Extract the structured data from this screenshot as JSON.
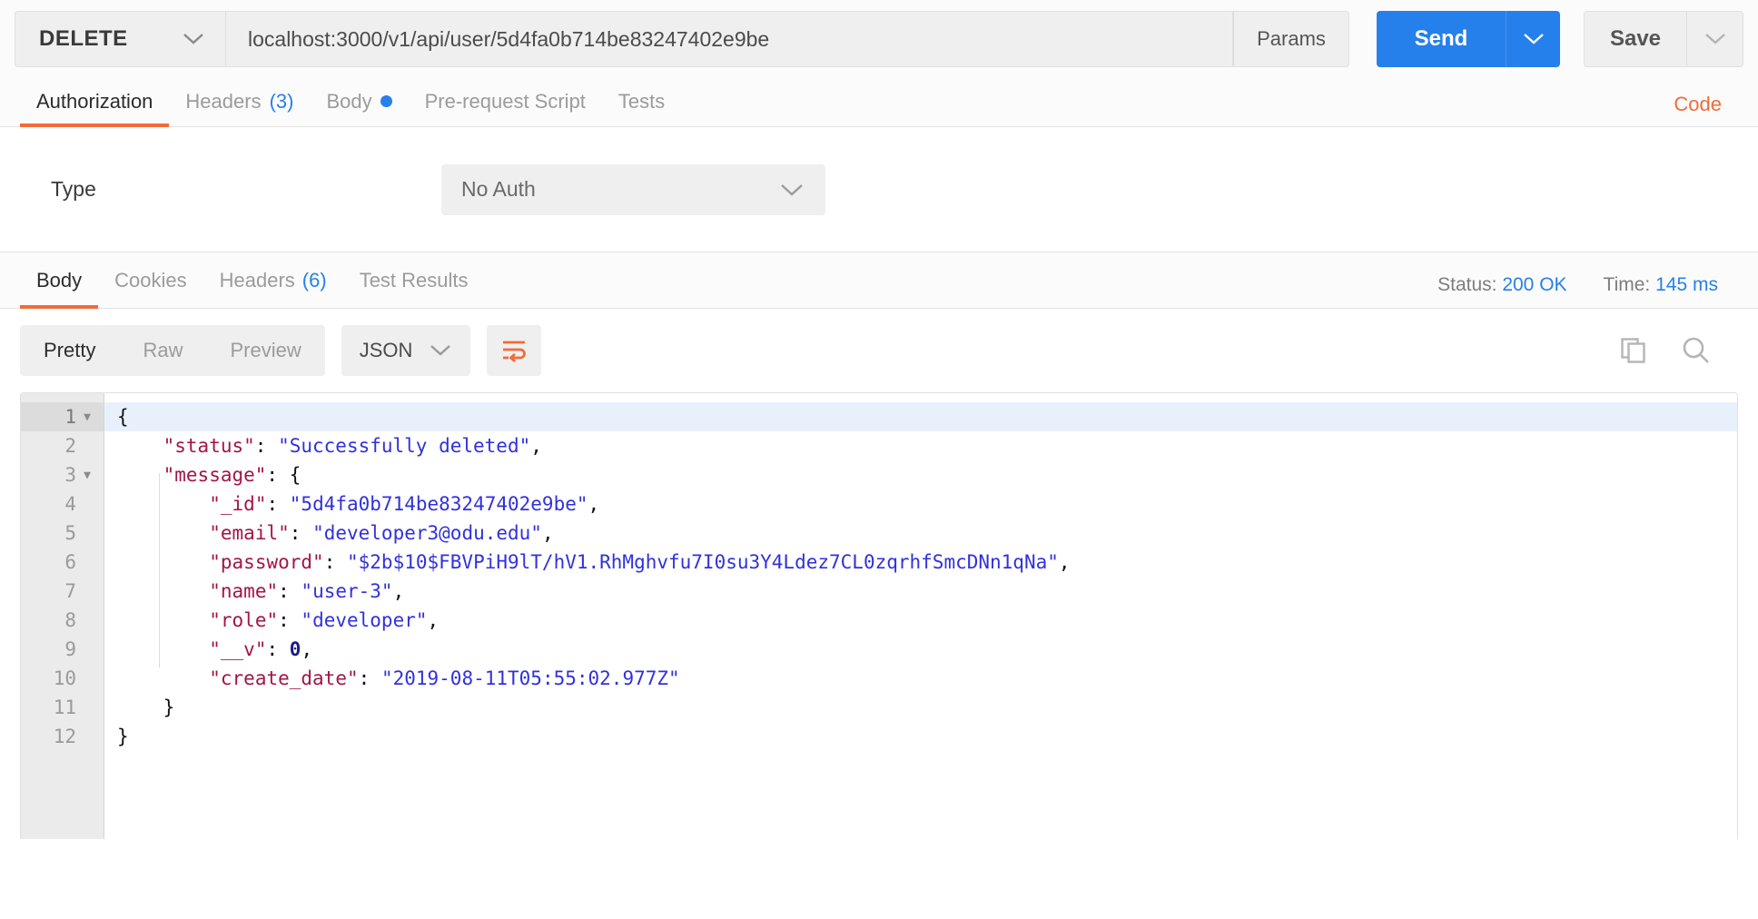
{
  "request": {
    "method": "DELETE",
    "url": "localhost:3000/v1/api/user/5d4fa0b714be83247402e9be",
    "params_label": "Params",
    "send_label": "Send",
    "save_label": "Save"
  },
  "request_tabs": {
    "items": [
      {
        "label": "Authorization",
        "count": "",
        "dot": false,
        "active": true
      },
      {
        "label": "Headers",
        "count": "(3)",
        "dot": false,
        "active": false
      },
      {
        "label": "Body",
        "count": "",
        "dot": true,
        "active": false
      },
      {
        "label": "Pre-request Script",
        "count": "",
        "dot": false,
        "active": false
      },
      {
        "label": "Tests",
        "count": "",
        "dot": false,
        "active": false
      }
    ],
    "code_link": "Code"
  },
  "auth": {
    "type_label": "Type",
    "selected": "No Auth"
  },
  "response_tabs": {
    "items": [
      {
        "label": "Body",
        "count": "",
        "active": true
      },
      {
        "label": "Cookies",
        "count": "",
        "active": false
      },
      {
        "label": "Headers",
        "count": "(6)",
        "active": false
      },
      {
        "label": "Test Results",
        "count": "",
        "active": false
      }
    ],
    "status_label": "Status:",
    "status_value": "200 OK",
    "time_label": "Time:",
    "time_value": "145 ms"
  },
  "body_toolbar": {
    "views": [
      {
        "label": "Pretty",
        "active": true
      },
      {
        "label": "Raw",
        "active": false
      },
      {
        "label": "Preview",
        "active": false
      }
    ],
    "format": "JSON",
    "wrap_icon": "word-wrap-icon",
    "copy_icon": "copy-icon",
    "search_icon": "search-icon"
  },
  "response_body": {
    "lines": [
      {
        "n": "1",
        "fold": true,
        "current": true,
        "text": "{"
      },
      {
        "n": "2",
        "fold": false,
        "current": false,
        "text": "    \"status\": \"Successfully deleted\","
      },
      {
        "n": "3",
        "fold": true,
        "current": false,
        "text": "    \"message\": {"
      },
      {
        "n": "4",
        "fold": false,
        "current": false,
        "text": "        \"_id\": \"5d4fa0b714be83247402e9be\","
      },
      {
        "n": "5",
        "fold": false,
        "current": false,
        "text": "        \"email\": \"developer3@odu.edu\","
      },
      {
        "n": "6",
        "fold": false,
        "current": false,
        "text": "        \"password\": \"$2b$10$FBVPiH9lT/hV1.RhMghvfu7I0su3Y4Ldez7CL0zqrhfSmcDNn1qNa\","
      },
      {
        "n": "7",
        "fold": false,
        "current": false,
        "text": "        \"name\": \"user-3\","
      },
      {
        "n": "8",
        "fold": false,
        "current": false,
        "text": "        \"role\": \"developer\","
      },
      {
        "n": "9",
        "fold": false,
        "current": false,
        "text": "        \"__v\": 0,"
      },
      {
        "n": "10",
        "fold": false,
        "current": false,
        "text": "        \"create_date\": \"2019-08-11T05:55:02.977Z\""
      },
      {
        "n": "11",
        "fold": false,
        "current": false,
        "text": "    }"
      },
      {
        "n": "12",
        "fold": false,
        "current": false,
        "text": "}"
      }
    ],
    "parsed": {
      "status": "Successfully deleted",
      "message": {
        "_id": "5d4fa0b714be83247402e9be",
        "email": "developer3@odu.edu",
        "password": "$2b$10$FBVPiH9lT/hV1.RhMghvfu7I0su3Y4Ldez7CL0zqrhfSmcDNn1qNa",
        "name": "user-3",
        "role": "developer",
        "__v": 0,
        "create_date": "2019-08-11T05:55:02.977Z"
      }
    }
  },
  "colors": {
    "accent_orange": "#f26b3a",
    "accent_blue": "#2680eb",
    "key_color": "#a31545",
    "string_color": "#3131dd",
    "number_color": "#1a1a8c"
  }
}
